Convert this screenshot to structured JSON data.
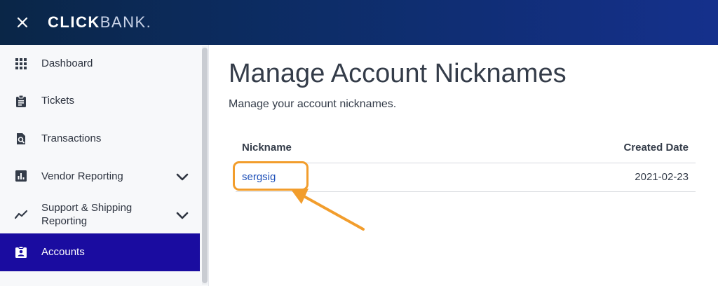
{
  "header": {
    "logo_click": "CLICK",
    "logo_bank": "BANK",
    "logo_mark": "."
  },
  "icons": {
    "close": "close-icon",
    "dashboard": "grid-icon",
    "tickets": "clipboard-icon",
    "transactions": "document-search-icon",
    "vendor_reporting": "bar-chart-icon",
    "support_shipping": "trend-line-icon",
    "accounts": "account-badge-icon",
    "chevron": "chevron-down-icon"
  },
  "sidebar": {
    "items": [
      {
        "label": "Dashboard"
      },
      {
        "label": "Tickets"
      },
      {
        "label": "Transactions"
      },
      {
        "label": "Vendor Reporting"
      },
      {
        "label_line1": "Support & Shipping",
        "label_line2": "Reporting"
      },
      {
        "label": "Accounts",
        "active": true
      }
    ]
  },
  "main": {
    "title": "Manage Account Nicknames",
    "subtitle": "Manage your account nicknames.",
    "table": {
      "columns": [
        "Nickname",
        "Created Date"
      ],
      "rows": [
        {
          "nickname": "sergsig",
          "created_date": "2021-02-23"
        }
      ]
    }
  },
  "colors": {
    "accent_active": "#1a0ca0",
    "link": "#1d4fb8",
    "highlight": "#f29d2c",
    "header_start": "#0a2647",
    "header_end": "#15308c"
  }
}
